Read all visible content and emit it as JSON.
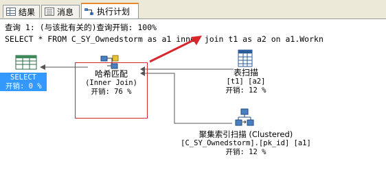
{
  "tabs": [
    {
      "label": "结果",
      "icon": "results-grid-icon"
    },
    {
      "label": "消息",
      "icon": "messages-icon"
    },
    {
      "label": "执行计划",
      "icon": "execution-plan-icon",
      "active": true
    }
  ],
  "query_header": "查询 1: (与该批有关的)查询开销: 100%",
  "query_sql": "SELECT * FROM C_SY_Ownedstorm as a1 inner join t1 as a2 on a1.Workn",
  "nodes": {
    "select": {
      "title": "SELECT",
      "cost": "开销: 0 %"
    },
    "hash_match": {
      "title": "哈希匹配",
      "subtitle": "(Inner Join)",
      "cost": "开销: 76 %"
    },
    "table_scan": {
      "title": "表扫描",
      "subtitle": "[t1] [a2]",
      "cost": "开销: 12 %"
    },
    "clustered_scan": {
      "title": "聚集索引扫描 (Clustered)",
      "subtitle": "[C_SY_Ownedstorm].[pk_id] [a1]",
      "cost": "开销: 12 %"
    }
  },
  "colors": {
    "highlight": "#3399ff",
    "annotation": "#d9262c"
  }
}
